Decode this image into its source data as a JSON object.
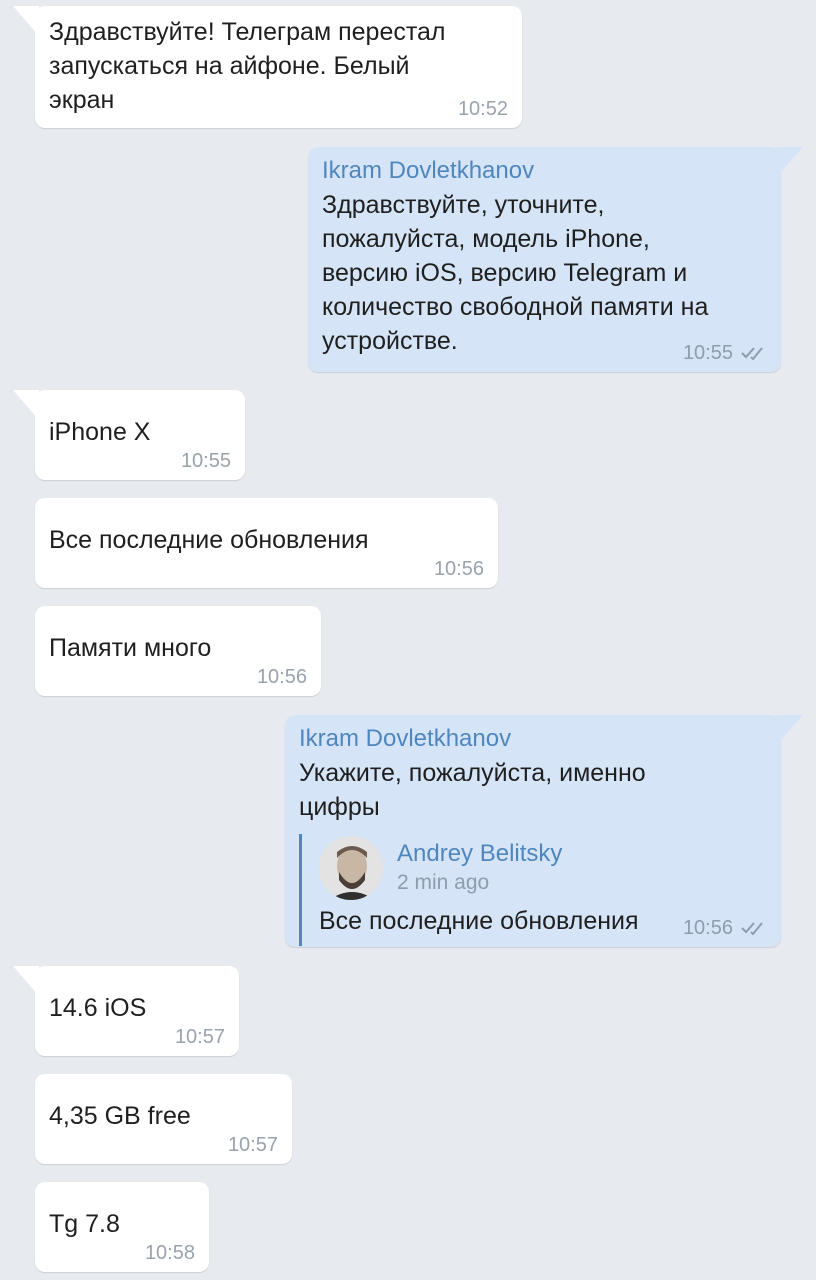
{
  "messages": [
    {
      "text": "Здравствуйте! Телеграм перестал\nзапускаться на айфоне. Белый\nэкран",
      "time": "10:52"
    },
    {
      "sender": "Ikram Dovletkhanov",
      "text": "Здравствуйте, уточните,\nпожалуйста, модель iPhone,\nверсию iOS, версию Telegram и\nколичество свободной памяти на\nустройстве.",
      "time": "10:55"
    },
    {
      "text": "iPhone X",
      "time": "10:55"
    },
    {
      "text": "Все последние обновления",
      "time": "10:56"
    },
    {
      "text": "Памяти много",
      "time": "10:56"
    },
    {
      "sender": "Ikram Dovletkhanov",
      "text": "Укажите, пожалуйста, именно\nцифры",
      "time": "10:56",
      "reply": {
        "name": "Andrey Belitsky",
        "time": "2 min ago",
        "text": "Все последние обновления"
      }
    },
    {
      "text": "14.6 iOS",
      "time": "10:57"
    },
    {
      "text": "4,35 GB free",
      "time": "10:57"
    },
    {
      "text": "Tg 7.8",
      "time": "10:58"
    }
  ]
}
